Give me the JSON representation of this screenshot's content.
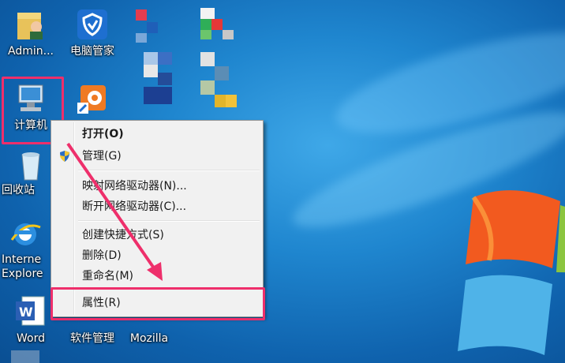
{
  "desktop": {
    "icons": [
      {
        "label": "Admin...",
        "icon": "user-folder-icon"
      },
      {
        "label": "电脑管家",
        "icon": "shield-icon"
      },
      {
        "label": "计算机",
        "icon": "computer-icon"
      },
      {
        "label": "",
        "icon": "shortcut-app-icon"
      },
      {
        "label": "回收站",
        "icon": "recycle-bin-icon"
      },
      {
        "label": "Interne Explore",
        "icon": "internet-explorer-icon"
      },
      {
        "label": "Word",
        "icon": "word-icon"
      },
      {
        "label": "软件管理",
        "icon": "software-manager-icon"
      },
      {
        "label": "Mozilla",
        "icon": "mozilla-icon"
      }
    ]
  },
  "context_menu": {
    "items": [
      {
        "label": "打开(O)",
        "bold": true
      },
      {
        "label": "管理(G)",
        "icon": "uac-shield-icon"
      },
      {
        "label": "映射网络驱动器(N)..."
      },
      {
        "label": "断开网络驱动器(C)..."
      },
      {
        "label": "创建快捷方式(S)"
      },
      {
        "label": "删除(D)"
      },
      {
        "label": "重命名(M)"
      },
      {
        "label": "属性(R)"
      }
    ]
  },
  "annotations": {
    "highlight_color": "#ee2f6b",
    "arrow_color": "#ee2f6b"
  }
}
